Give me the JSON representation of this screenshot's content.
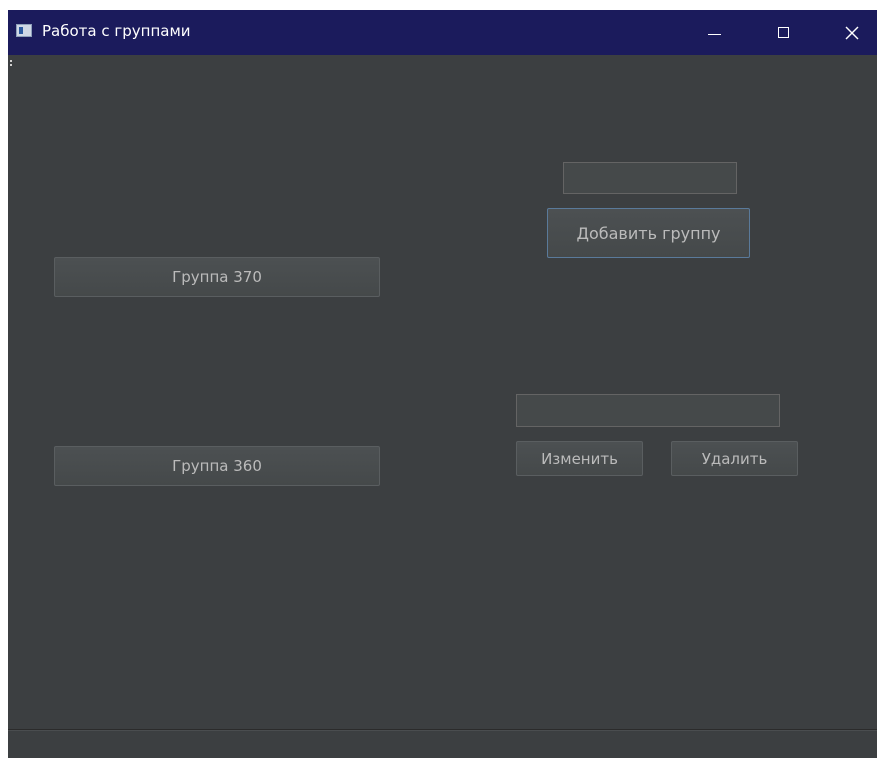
{
  "window": {
    "title": "Работа с группами",
    "icon": "app-window-icon",
    "controls": {
      "minimize_icon": "minimize-icon",
      "maximize_icon": "maximize-icon",
      "close_icon": "close-icon"
    }
  },
  "groups": [
    {
      "label": "Группа 370"
    },
    {
      "label": "Группа 360"
    }
  ],
  "add_panel": {
    "input_value": "",
    "add_button_label": "Добавить группу"
  },
  "edit_panel": {
    "input_value": "",
    "edit_button_label": "Изменить",
    "delete_button_label": "Удалить"
  },
  "colors": {
    "titlebar": "#1b1b5c",
    "background": "#3c3f41",
    "button": "#4c5052",
    "button_text": "#bbbbbb"
  }
}
